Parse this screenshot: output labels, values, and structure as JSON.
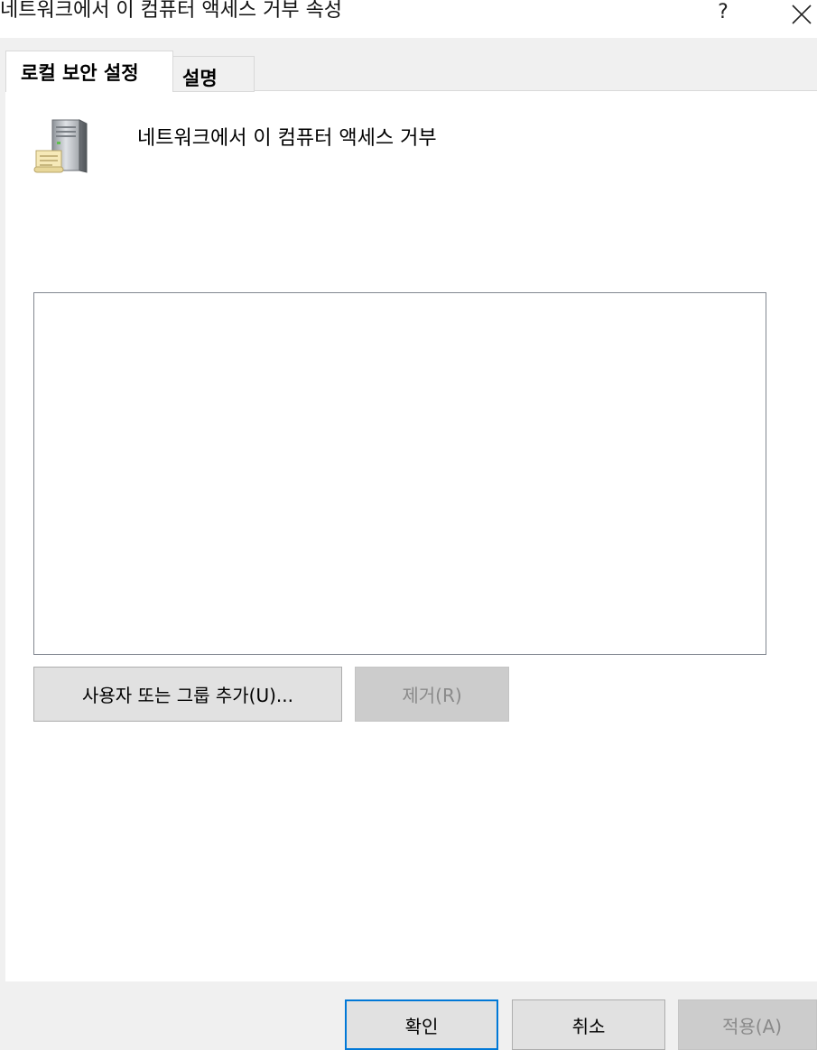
{
  "window": {
    "title": "네트워크에서 이 컴퓨터 액세스 거부 속성",
    "help_label": "?"
  },
  "tabs": [
    {
      "label": "로컬 보안 설정",
      "selected": true
    },
    {
      "label": "설명",
      "selected": false
    }
  ],
  "policy": {
    "name": "네트워크에서 이 컴퓨터 액세스 거부",
    "icon": "server-policy-icon",
    "members": []
  },
  "buttons": {
    "add_label": "사용자 또는 그룹 추가(U)...",
    "remove_label": "제거(R)",
    "ok_label": "확인",
    "cancel_label": "취소",
    "apply_label": "적용(A)"
  },
  "colors": {
    "focus_border": "#0078d7",
    "disabled_text": "#8a8a8a",
    "disabled_bg": "#cccccc",
    "button_bg": "#e1e1e1",
    "dialog_bg": "#f0f0f0"
  }
}
